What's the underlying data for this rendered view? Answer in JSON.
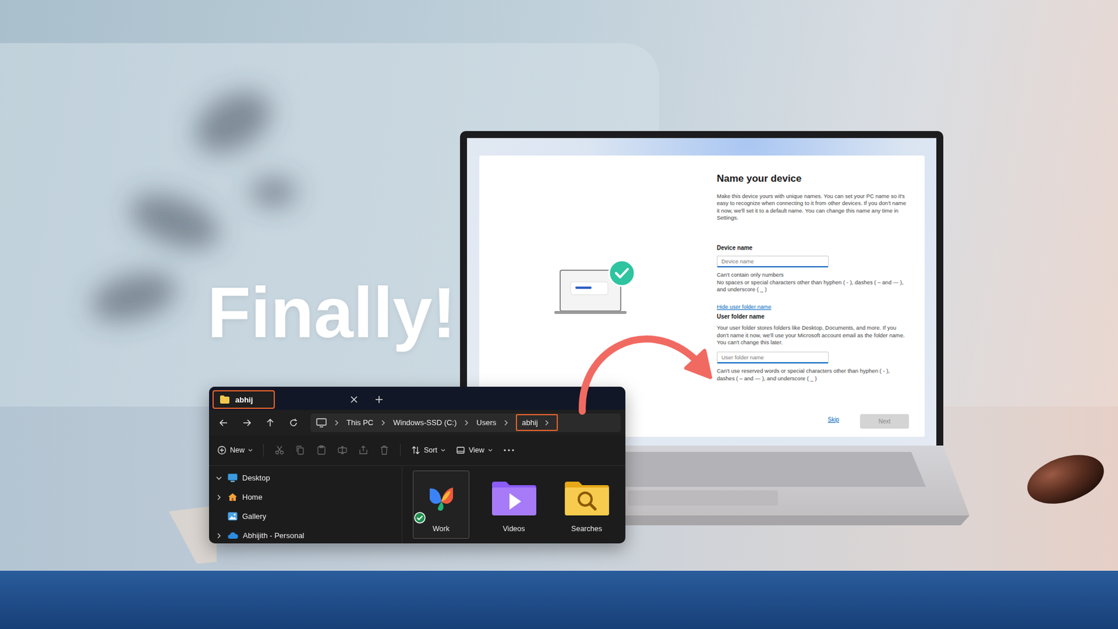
{
  "headline": "Finally!",
  "setup": {
    "title": "Name your device",
    "intro": "Make this device yours with unique names. You can set your PC name so it's easy to recognize when connecting to it from other devices. If you don't name it now, we'll set it to a default name. You can change this name any time in Settings.",
    "device_name": {
      "label": "Device name",
      "placeholder": "Device name",
      "hints": [
        "Can't contain only numbers",
        "No spaces or special characters other than hyphen ( - ), dashes ( – and — ), and underscore ( _ )"
      ]
    },
    "toggle_link": "Hide user folder name",
    "user_folder": {
      "label": "User folder name",
      "description": "Your user folder stores folders like Desktop, Documents, and more. If you don't name it now, we'll use your Microsoft account email as the folder name. You can't change this later.",
      "placeholder": "User folder name",
      "hint": "Can't use reserved words or special characters other than hyphen ( - ), dashes ( – and — ), and underscore ( _ )"
    },
    "buttons": [
      {
        "label": "Skip",
        "kind": "link",
        "disabled": false
      },
      {
        "label": "Next",
        "kind": "primary",
        "disabled": true
      }
    ]
  },
  "explorer": {
    "tab": {
      "label": "abhij",
      "highlighted": true
    },
    "breadcrumb": [
      {
        "label": "This PC",
        "highlighted": false
      },
      {
        "label": "Windows-SSD (C:)",
        "highlighted": false
      },
      {
        "label": "Users",
        "highlighted": false
      },
      {
        "label": "abhij",
        "highlighted": true
      }
    ],
    "toolbar": [
      {
        "kind": "menu",
        "label": "New"
      },
      {
        "kind": "icon",
        "disabled": true
      },
      {
        "kind": "icon",
        "disabled": true
      },
      {
        "kind": "icon",
        "disabled": true
      },
      {
        "kind": "icon",
        "disabled": true
      },
      {
        "kind": "icon",
        "disabled": true
      },
      {
        "kind": "icon",
        "disabled": true
      },
      {
        "kind": "menu",
        "label": "Sort"
      },
      {
        "kind": "menu",
        "label": "View"
      },
      {
        "kind": "more"
      }
    ],
    "sidebar": [
      {
        "label": "Desktop",
        "expandable": true,
        "expanded": true,
        "child": false
      },
      {
        "label": "Home",
        "expandable": true,
        "expanded": false,
        "child": true
      },
      {
        "label": "Gallery",
        "expandable": false,
        "expanded": false,
        "child": true
      },
      {
        "label": "Abhijith - Personal",
        "expandable": true,
        "expanded": false,
        "child": true
      }
    ],
    "items": [
      {
        "label": "Work",
        "selected": true,
        "synced": true
      },
      {
        "label": "Videos",
        "selected": false,
        "synced": false
      },
      {
        "label": "Searches",
        "selected": false,
        "synced": false
      }
    ]
  }
}
